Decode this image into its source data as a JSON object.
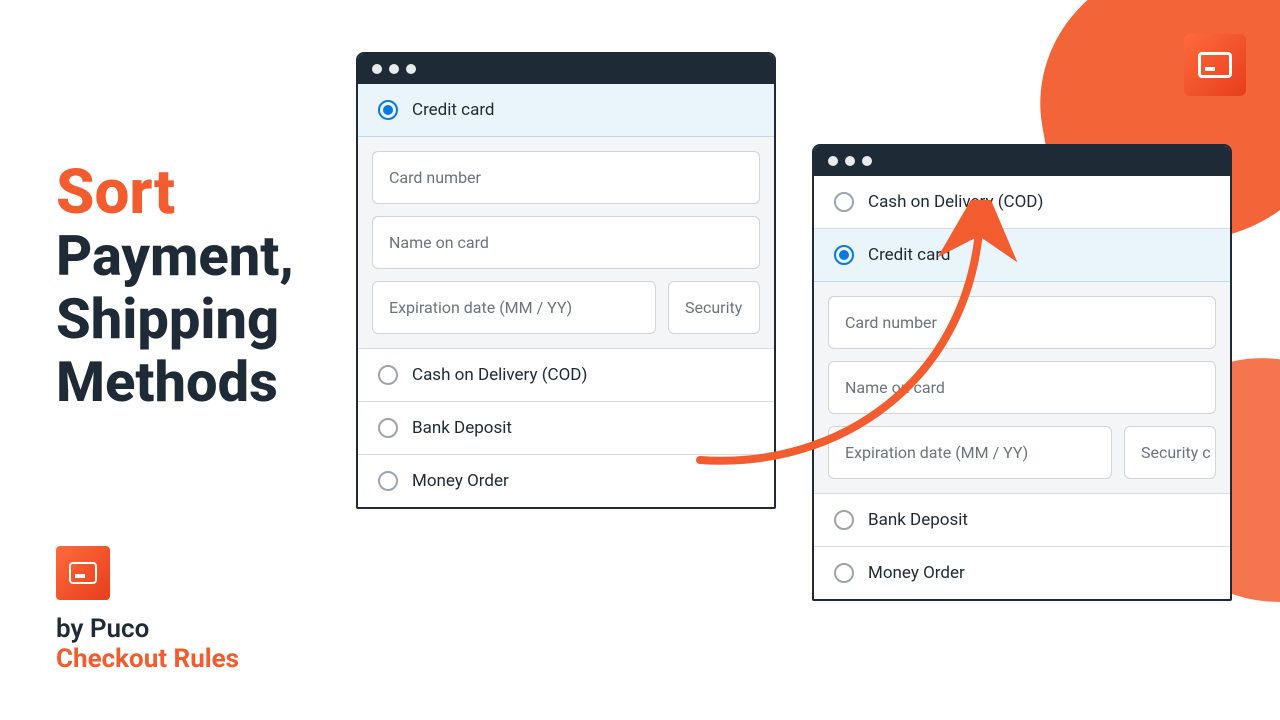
{
  "headline": {
    "line1": "Sort",
    "line2": "Payment,",
    "line3": "Shipping",
    "line4": "Methods"
  },
  "byline": {
    "line1": "by Puco",
    "line2": "Checkout Rules"
  },
  "mockA": {
    "options": {
      "credit": "Credit card",
      "cod": "Cash on Delivery (COD)",
      "bank": "Bank Deposit",
      "money": "Money Order"
    },
    "fields": {
      "card_number": "Card number",
      "name_on_card": "Name on card",
      "expiry": "Expiration date (MM / YY)",
      "security": "Security"
    }
  },
  "mockB": {
    "options": {
      "cod": "Cash on Delivery (COD)",
      "credit": "Credit card",
      "bank": "Bank Deposit",
      "money": "Money Order"
    },
    "fields": {
      "card_number": "Card number",
      "name_on_card": "Name on card",
      "expiry": "Expiration date (MM / YY)",
      "security": "Security c"
    }
  },
  "colors": {
    "accent": "#f25c2e",
    "dark": "#1f2a37",
    "blue": "#0a7ae0"
  }
}
